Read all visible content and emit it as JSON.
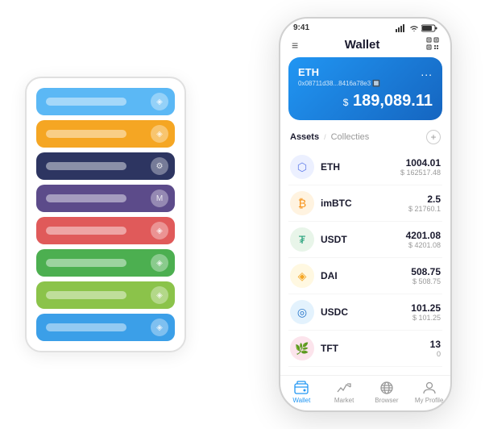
{
  "scene": {
    "background": "#ffffff"
  },
  "card_stack": {
    "items": [
      {
        "color": "#5bb8f5",
        "label": "",
        "icon": "◈"
      },
      {
        "color": "#f5a623",
        "label": "",
        "icon": "◈"
      },
      {
        "color": "#2d3561",
        "label": "",
        "icon": "⚙"
      },
      {
        "color": "#5c4b8a",
        "label": "",
        "icon": "M"
      },
      {
        "color": "#e05a5a",
        "label": "",
        "icon": "◈"
      },
      {
        "color": "#4caf50",
        "label": "",
        "icon": "◈"
      },
      {
        "color": "#8bc34a",
        "label": "",
        "icon": "◈"
      },
      {
        "color": "#3b9fe8",
        "label": "",
        "icon": "◈"
      }
    ]
  },
  "phone": {
    "status_bar": {
      "time": "9:41"
    },
    "header": {
      "title": "Wallet",
      "menu_icon": "≡",
      "qr_icon": "⛶"
    },
    "eth_card": {
      "name": "ETH",
      "address": "0x08711d38...8416a78e3",
      "address_suffix": "🔲",
      "dots": "...",
      "currency_symbol": "$",
      "balance": "189,089.11"
    },
    "assets_header": {
      "tab_active": "Assets",
      "separator": "/",
      "tab_inactive": "Collecties",
      "add_icon": "+"
    },
    "assets": [
      {
        "name": "ETH",
        "icon_type": "eth",
        "icon_char": "⬡",
        "amount": "1004.01",
        "usd": "$ 162517.48"
      },
      {
        "name": "imBTC",
        "icon_type": "imbtc",
        "icon_char": "₿",
        "amount": "2.5",
        "usd": "$ 21760.1"
      },
      {
        "name": "USDT",
        "icon_type": "usdt",
        "icon_char": "₮",
        "amount": "4201.08",
        "usd": "$ 4201.08"
      },
      {
        "name": "DAI",
        "icon_type": "dai",
        "icon_char": "◈",
        "amount": "508.75",
        "usd": "$ 508.75"
      },
      {
        "name": "USDC",
        "icon_type": "usdc",
        "icon_char": "◎",
        "amount": "101.25",
        "usd": "$ 101.25"
      },
      {
        "name": "TFT",
        "icon_type": "tft",
        "icon_char": "🌿",
        "amount": "13",
        "usd": "0"
      }
    ],
    "bottom_nav": [
      {
        "label": "Wallet",
        "icon": "◎",
        "active": true
      },
      {
        "label": "Market",
        "icon": "📈",
        "active": false
      },
      {
        "label": "Browser",
        "icon": "👤",
        "active": false
      },
      {
        "label": "My Profile",
        "icon": "👤",
        "active": false
      }
    ]
  }
}
